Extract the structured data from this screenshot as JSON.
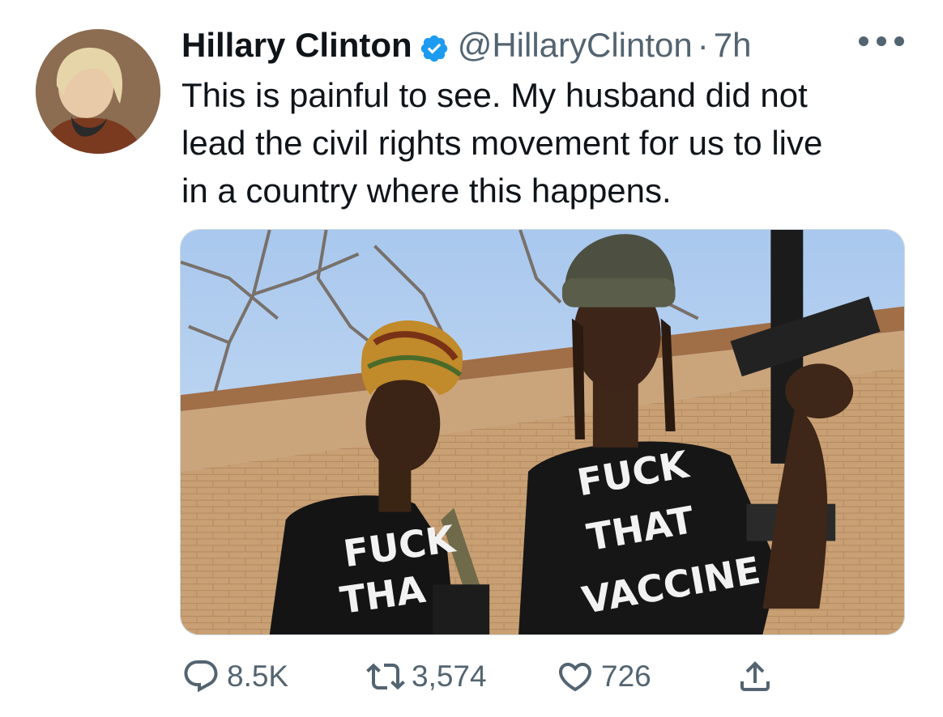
{
  "author": {
    "name": "Hillary Clinton",
    "handle": "@HillaryClinton",
    "separator": "·",
    "time": "7h",
    "verified": true
  },
  "tweet": {
    "line1": "This is painful to see. My husband did not",
    "line2": "lead the civil rights movement for us to live",
    "line3": "in a country where this happens."
  },
  "media": {
    "shirt_left": [
      "FUCK",
      "THA"
    ],
    "shirt_right": [
      "FUCK",
      "THAT",
      "VACCINE"
    ]
  },
  "actions": {
    "replies": "8.5K",
    "retweets": "3,574",
    "likes": "726"
  },
  "icons": {
    "verified": "verified-badge-icon",
    "more": "more-dots-icon",
    "reply": "reply-icon",
    "retweet": "retweet-icon",
    "like": "heart-icon",
    "share": "share-icon"
  },
  "colors": {
    "text": "#0f1419",
    "secondary": "#536471",
    "verified": "#1d9bf0"
  }
}
